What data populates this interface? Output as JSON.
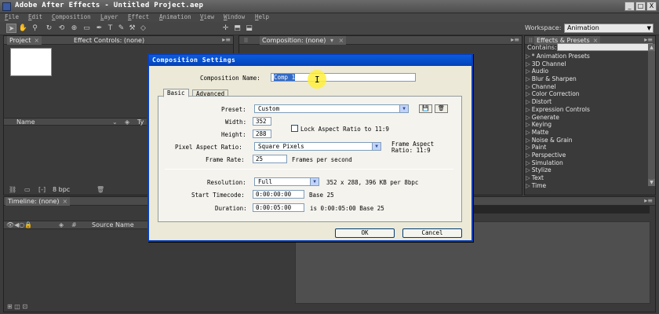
{
  "app": {
    "title": "Adobe After Effects - Untitled Project.aep",
    "window_controls": [
      "_",
      "□",
      "X"
    ]
  },
  "menu": [
    "File",
    "Edit",
    "Composition",
    "Layer",
    "Effect",
    "Animation",
    "View",
    "Window",
    "Help"
  ],
  "toolbar": {
    "workspace_label": "Workspace:",
    "workspace_value": "Animation"
  },
  "project_panel": {
    "tabs": [
      "Project",
      "Effect Controls: (none)"
    ],
    "columns": [
      "Name",
      "Ty"
    ],
    "bit_depth": "8 bpc"
  },
  "composition_panel": {
    "tab": "Composition: (none)"
  },
  "effects_panel": {
    "tab": "Effects & Presets",
    "contains_label": "Contains:",
    "items": [
      "* Animation Presets",
      "3D Channel",
      "Audio",
      "Blur & Sharpen",
      "Channel",
      "Color Correction",
      "Distort",
      "Expression Controls",
      "Generate",
      "Keying",
      "Matte",
      "Noise & Grain",
      "Paint",
      "Perspective",
      "Simulation",
      "Stylize",
      "Text",
      "Time"
    ]
  },
  "timeline_panel": {
    "tab": "Timeline: (none)",
    "source_name": "Source Name"
  },
  "dialog": {
    "title": "Composition Settings",
    "comp_name_label": "Composition Name:",
    "comp_name_value": "Comp 1",
    "tabs": [
      "Basic",
      "Advanced"
    ],
    "preset_label": "Preset:",
    "preset_value": "Custom",
    "width_label": "Width:",
    "width_value": "352",
    "height_label": "Height:",
    "height_value": "288",
    "lock_label": "Lock Aspect Ratio to 11:9",
    "lock_checked": false,
    "par_label": "Pixel Aspect Ratio:",
    "par_value": "Square Pixels",
    "frame_aspect_line1": "Frame Aspect",
    "frame_aspect_line2": "Ratio: 11:9",
    "frame_rate_label": "Frame Rate:",
    "frame_rate_value": "25",
    "frame_rate_unit": "Frames per second",
    "resolution_label": "Resolution:",
    "resolution_value": "Full",
    "resolution_info": "352 x 288, 396 KB per 8bpc",
    "start_tc_label": "Start Timecode:",
    "start_tc_value": "0:00:00:00",
    "start_tc_base": "Base 25",
    "duration_label": "Duration:",
    "duration_value": "0:00:05:00",
    "duration_info": "is 0:00:05:00  Base 25",
    "ok_label": "OK",
    "cancel_label": "Cancel"
  }
}
